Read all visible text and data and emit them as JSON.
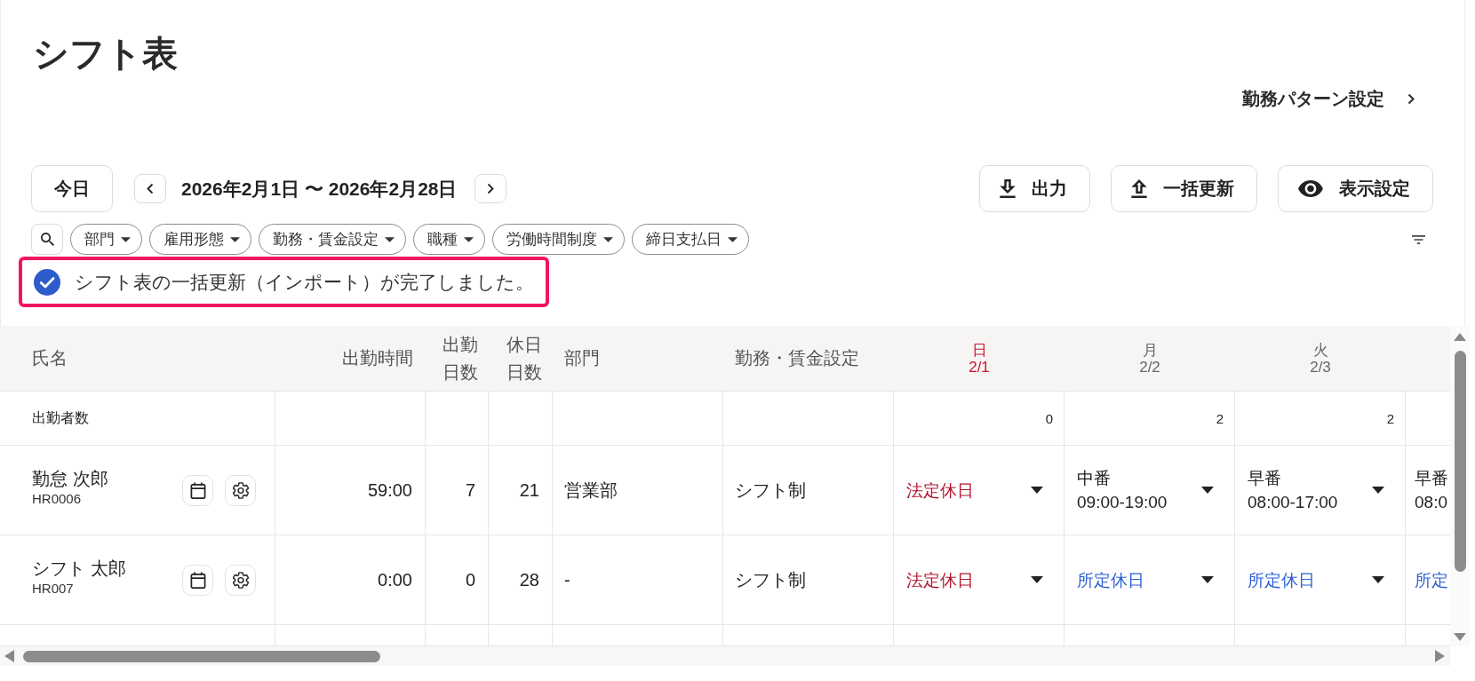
{
  "page": {
    "title": "シフト表",
    "settings_link": "勤務パターン設定"
  },
  "toolbar": {
    "today": "今日",
    "period": "2026年2月1日 〜 2026年2月28日",
    "actions": [
      {
        "kind": "download",
        "label": "出力"
      },
      {
        "kind": "upload",
        "label": "一括更新"
      },
      {
        "kind": "view",
        "label": "表示設定"
      }
    ]
  },
  "filters": [
    {
      "label": "部門"
    },
    {
      "label": "雇用形態"
    },
    {
      "label": "勤務・賃金設定"
    },
    {
      "label": "職種"
    },
    {
      "label": "労働時間制度"
    },
    {
      "label": "締日支払日"
    }
  ],
  "notice": {
    "text": "シフト表の一括更新（インポート）が完了しました。",
    "highlighted": true
  },
  "table": {
    "columns": {
      "name": "氏名",
      "hours": "出勤時間",
      "work_days": "出勤日数",
      "holidays": "休日日数",
      "department": "部門",
      "pay_setting": "勤務・賃金設定"
    },
    "days": [
      {
        "weekday": "日",
        "date": "2/1",
        "holiday": true
      },
      {
        "weekday": "月",
        "date": "2/2",
        "holiday": false
      },
      {
        "weekday": "火",
        "date": "2/3",
        "holiday": false
      }
    ],
    "count_row": {
      "label": "出勤者数",
      "counts": [
        "0",
        "2",
        "2"
      ]
    },
    "rows": [
      {
        "name": "勤怠 次郎",
        "id": "HR0006",
        "hours": "59:00",
        "work_days": "7",
        "holidays": "21",
        "department": "営業部",
        "pay_setting": "シフト制",
        "shifts": [
          {
            "kind": "legal_holiday",
            "label": "法定休日"
          },
          {
            "kind": "shift",
            "label": "中番",
            "time": "09:00-19:00"
          },
          {
            "kind": "shift",
            "label": "早番",
            "time": "08:00-17:00"
          },
          {
            "kind": "shift",
            "label": "早番",
            "time": "08:0"
          }
        ]
      },
      {
        "name": "シフト 太郎",
        "id": "HR007",
        "hours": "0:00",
        "work_days": "0",
        "holidays": "28",
        "department": "-",
        "pay_setting": "シフト制",
        "shifts": [
          {
            "kind": "legal_holiday",
            "label": "法定休日"
          },
          {
            "kind": "scheduled_holiday",
            "label": "所定休日"
          },
          {
            "kind": "scheduled_holiday",
            "label": "所定休日"
          },
          {
            "kind": "scheduled_holiday",
            "label": "所定"
          }
        ]
      }
    ]
  }
}
